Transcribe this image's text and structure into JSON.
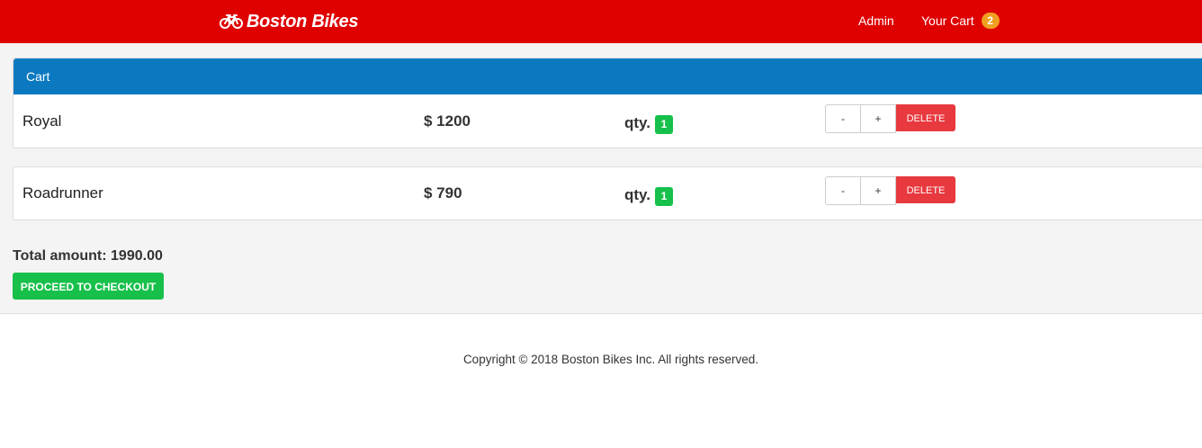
{
  "navbar": {
    "brand_icon": "bicycle-icon",
    "brand": "Boston Bikes",
    "admin_label": "Admin",
    "cart_label": "Your Cart",
    "cart_count": "2",
    "colors": {
      "navbar_bg": "#df0000",
      "badge": "#f0a020"
    }
  },
  "cart": {
    "heading": "Cart",
    "heading_color": "#0b79c0",
    "items": [
      {
        "name": "Royal",
        "price": "$ 1200",
        "qty_label": "qty.",
        "qty": "1",
        "minus_label": "-",
        "plus_label": "+",
        "delete_label": "DELETE"
      },
      {
        "name": "Roadrunner",
        "price": "$ 790",
        "qty_label": "qty.",
        "qty": "1",
        "minus_label": "-",
        "plus_label": "+",
        "delete_label": "DELETE"
      }
    ],
    "total_text": "Total amount: 1990.00",
    "checkout_label": "PROCEED TO CHECKOUT",
    "colors": {
      "qty_badge": "#17c04a",
      "delete": "#e8393f",
      "checkout": "#17c04a"
    }
  },
  "footer": {
    "copyright": "Copyright © 2018 Boston Bikes Inc. All rights reserved."
  }
}
